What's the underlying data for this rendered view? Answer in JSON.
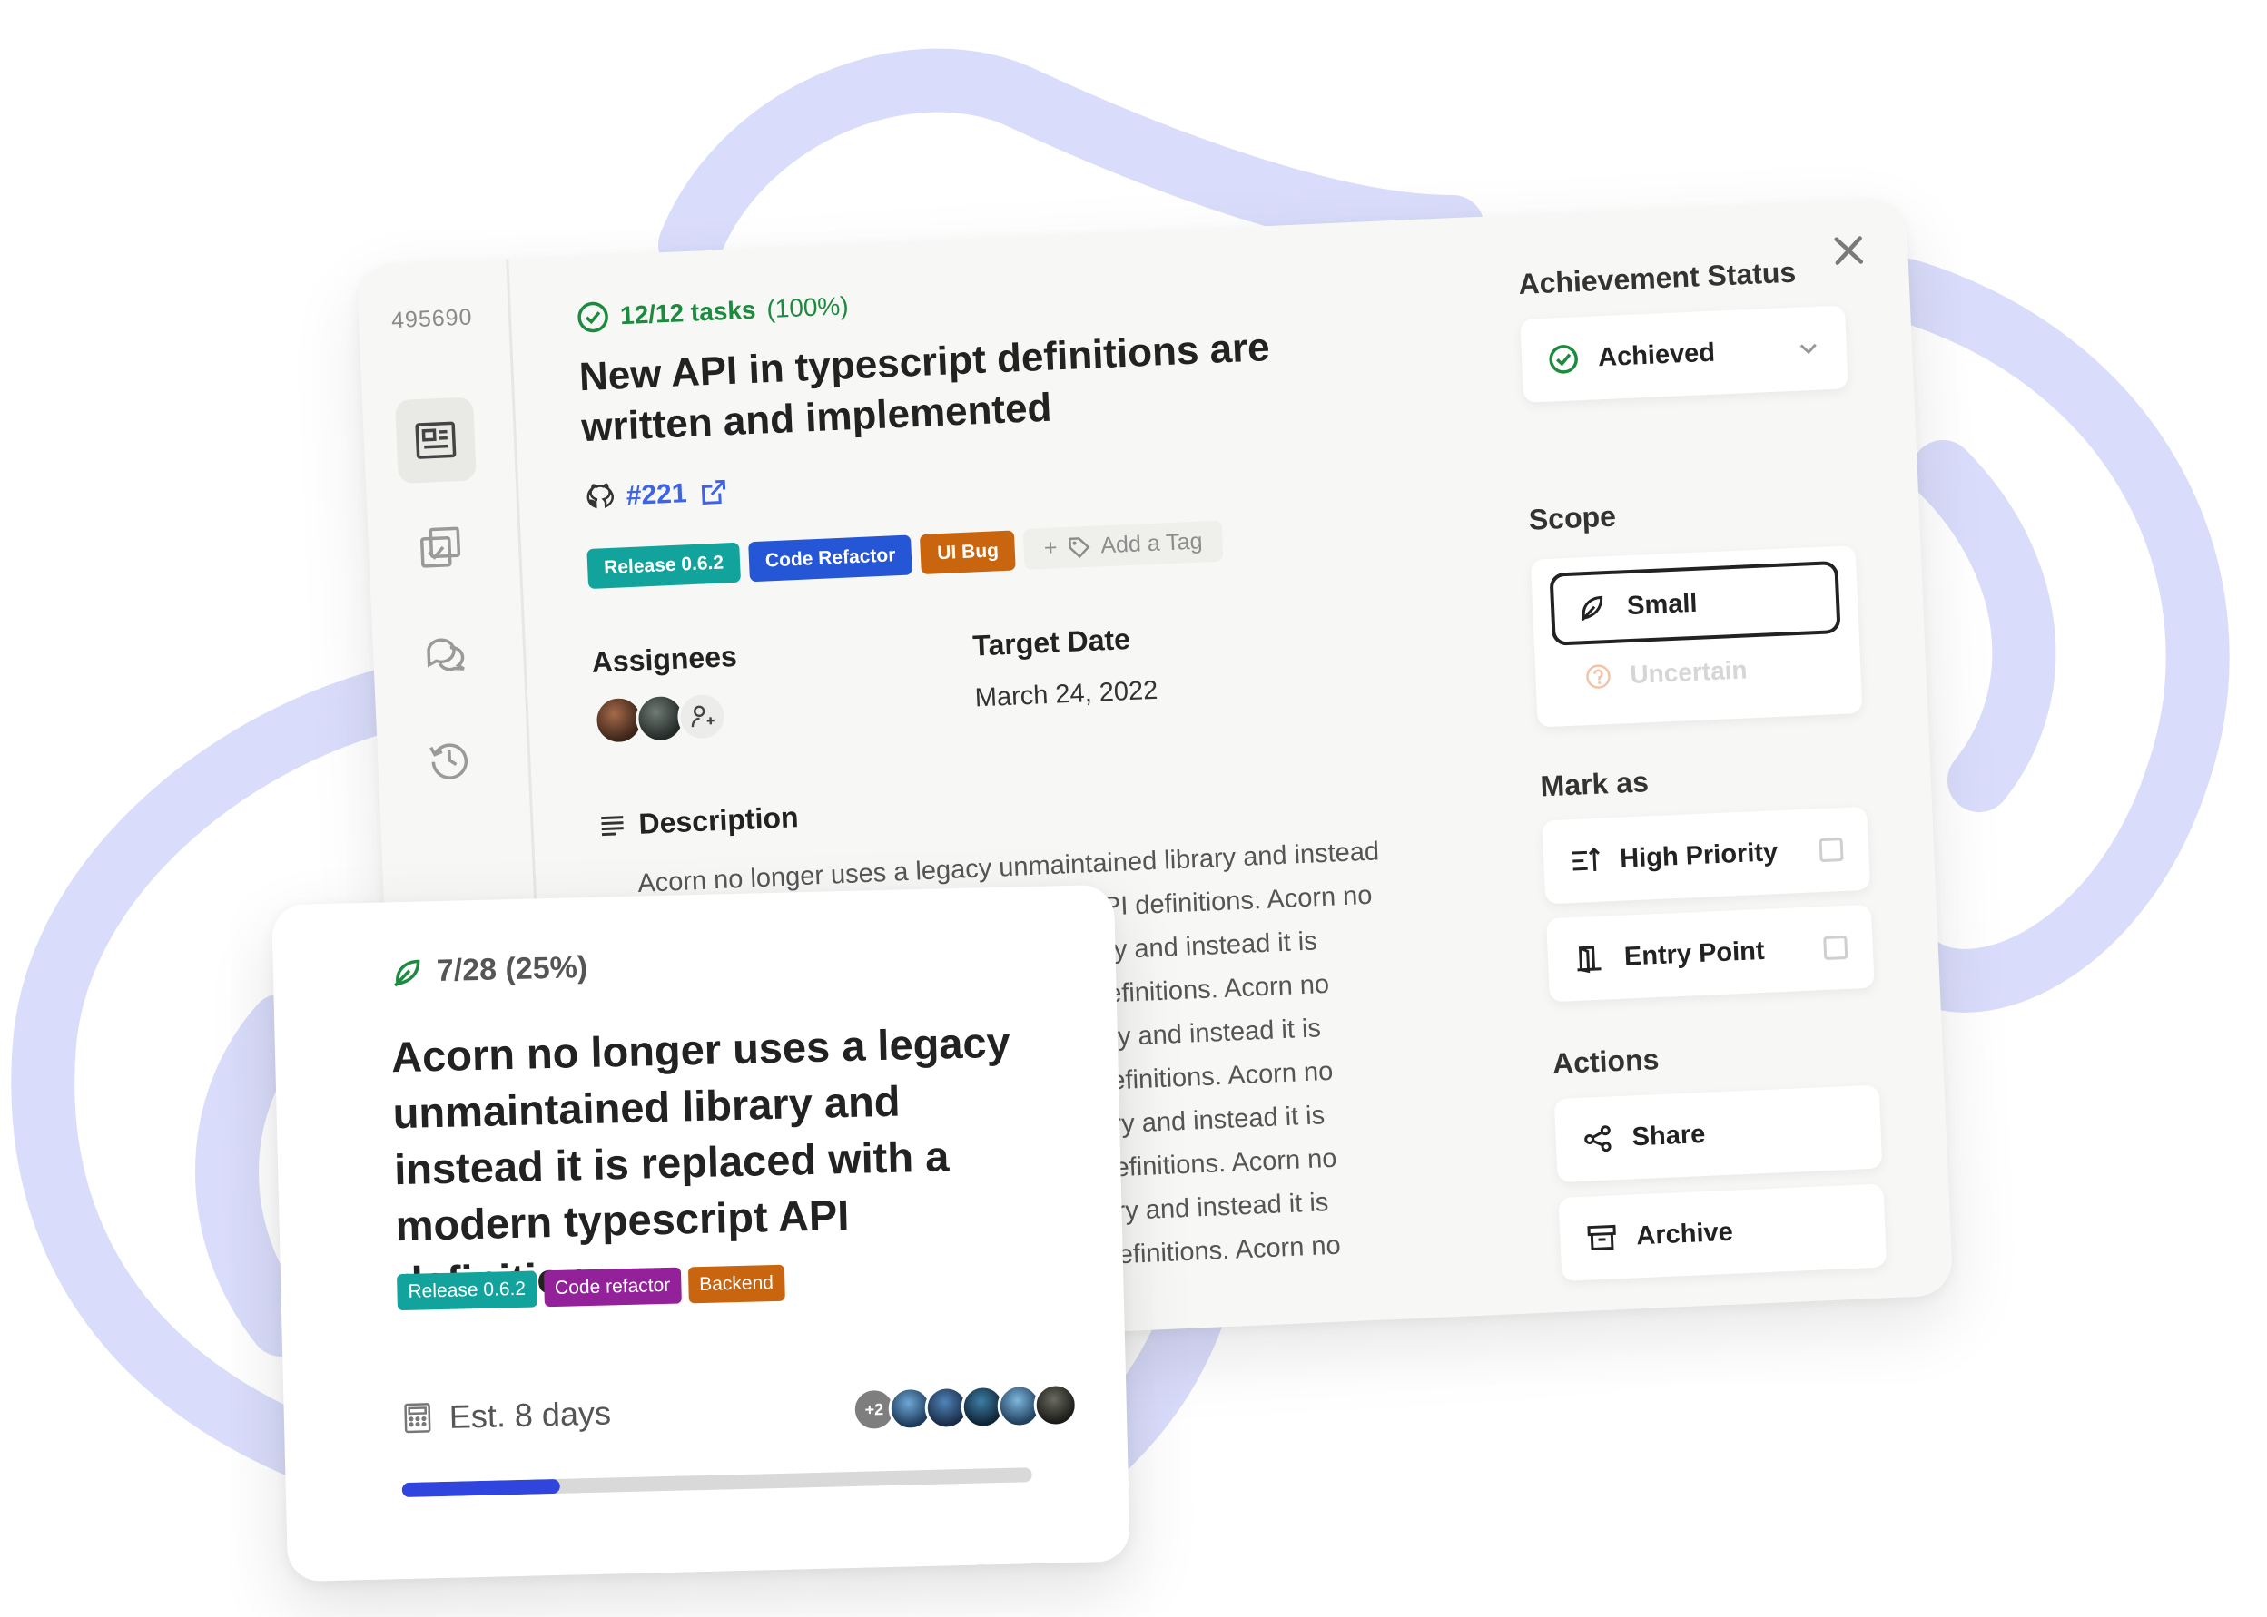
{
  "modal": {
    "issue_id": "495690",
    "progress": {
      "count": "12/12 tasks",
      "percent": "(100%)"
    },
    "title": "New API in typescript definitions are written and implemented",
    "github_ref": "#221",
    "tags": [
      {
        "label": "Release 0.6.2",
        "color": "#12a49c"
      },
      {
        "label": "Code Refactor",
        "color": "#2456d6"
      },
      {
        "label": "UI Bug",
        "color": "#c8650e"
      }
    ],
    "add_tag_label": "Add a Tag",
    "assignees_label": "Assignees",
    "target_date_label": "Target Date",
    "target_date_value": "March 24, 2022",
    "description_label": "Description",
    "description_text": "Acorn no longer uses a legacy unmaintained library and instead it is replaced with a modern typescript API definitions. Acorn no longer uses a legacy unmaintained library and instead it is replaced with a modern typescript API definitions. Acorn no longer uses a legacy unmaintained library and instead it is replaced with a modern typescript API definitions. Acorn no longer uses a legacy unmaintained library and instead it is replaced with a modern typescript API definitions. Acorn no longer uses a legacy unmaintained library and instead it is replaced with a modern typescript API definitions. Acorn no longer uses a legacy unmaintained library and instead it is",
    "side": {
      "achievement_status_label": "Achievement Status",
      "achievement_status_value": "Achieved",
      "scope_label": "Scope",
      "scope_selected": "Small",
      "scope_alt": "Uncertain",
      "mark_as_label": "Mark as",
      "mark_high_priority": "High Priority",
      "mark_entry_point": "Entry Point",
      "actions_label": "Actions",
      "action_share": "Share",
      "action_archive": "Archive"
    }
  },
  "card": {
    "progress": "7/28 (25%)",
    "title": "Acorn no longer uses a legacy unmaintained library and instead it is replaced with a modern typescript API definitions",
    "tags": [
      {
        "label": "Release 0.6.2",
        "color": "#12a49c"
      },
      {
        "label": "Code refactor",
        "color": "#93219a"
      },
      {
        "label": "Backend",
        "color": "#c8650e"
      }
    ],
    "estimate": "Est. 8 days",
    "more_assignees": "+2",
    "progress_fraction": 0.25
  },
  "colors": {
    "accent_green": "#1c8a3f",
    "link_blue": "#3f63e6",
    "bar_blue": "#2f45de",
    "swirl": "#d9dcfa"
  },
  "icons": [
    "check-circle-icon",
    "github-icon",
    "external-link-icon",
    "tag-icon",
    "close-icon",
    "details-icon",
    "tasks-icon",
    "comments-icon",
    "history-icon",
    "chevron-down-icon",
    "leaf-icon",
    "question-circle-icon",
    "priority-icon",
    "door-icon",
    "share-icon",
    "archive-icon",
    "calculator-icon",
    "add-person-icon",
    "text-lines-icon"
  ]
}
